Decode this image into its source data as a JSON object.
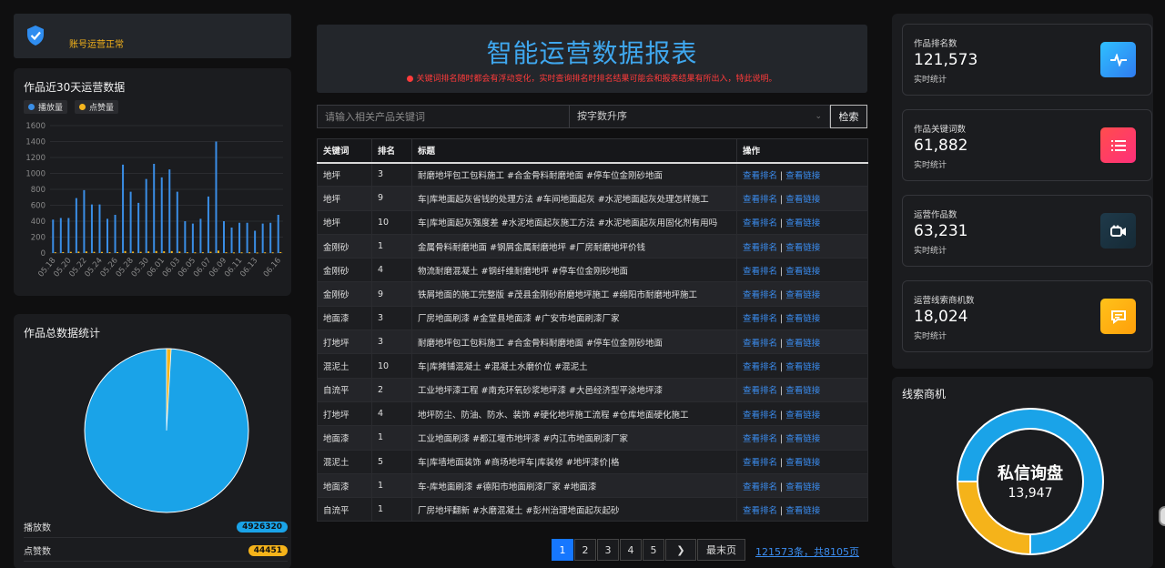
{
  "status": {
    "text": "账号运营正常"
  },
  "trend": {
    "title": "作品近30天运营数据",
    "legend": [
      "播放量",
      "点赞量"
    ],
    "colors": {
      "play": "#3a8ee6",
      "like": "#f6b61e"
    }
  },
  "chart_data": {
    "type": "bar",
    "xlabel": "",
    "ylabel": "",
    "ylim": [
      0,
      1600
    ],
    "yticks": [
      0,
      200,
      400,
      600,
      800,
      1000,
      1200,
      1400,
      1600
    ],
    "categories": [
      "05.18",
      "05.19",
      "05.20",
      "05.21",
      "05.22",
      "05.23",
      "05.24",
      "05.25",
      "05.26",
      "05.27",
      "05.28",
      "05.29",
      "05.30",
      "05.31",
      "06.01",
      "06.02",
      "06.03",
      "06.04",
      "06.05",
      "06.06",
      "06.07",
      "06.08",
      "06.09",
      "06.10",
      "06.11",
      "06.12",
      "06.13",
      "06.14",
      "06.15",
      "06.16"
    ],
    "tick_labels": [
      "05.18",
      "05.20",
      "05.22",
      "05.24",
      "05.26",
      "05.28",
      "05.30",
      "06.01",
      "06.03",
      "06.05",
      "06.07",
      "06.09",
      "06.11",
      "06.13",
      "06.16"
    ],
    "series": [
      {
        "name": "播放量",
        "values": [
          420,
          440,
          440,
          690,
          790,
          610,
          610,
          430,
          480,
          1110,
          770,
          630,
          930,
          1120,
          950,
          1050,
          770,
          400,
          370,
          430,
          710,
          1400,
          400,
          320,
          380,
          380,
          280,
          370,
          380,
          480
        ]
      },
      {
        "name": "点赞量",
        "values": [
          10,
          12,
          15,
          18,
          20,
          15,
          14,
          10,
          12,
          25,
          18,
          15,
          20,
          25,
          22,
          24,
          18,
          10,
          9,
          10,
          16,
          30,
          10,
          8,
          9,
          9,
          7,
          9,
          9,
          12
        ]
      }
    ]
  },
  "total": {
    "title": "作品总数据统计",
    "rows": [
      {
        "label": "播放数",
        "value": "4926320",
        "color": "#1aa3e8"
      },
      {
        "label": "点赞数",
        "value": "44451",
        "color": "#f5b31a"
      }
    ],
    "pie": {
      "play": 4926320,
      "like": 44451,
      "play_color": "#1aa3e8",
      "like_color": "#f5b31a"
    }
  },
  "header": {
    "title": "智能运营数据报表",
    "notice": "关键词排名随时都会有浮动变化，实时查询排名时排名结果可能会和报表结果有所出入，特此说明。"
  },
  "search": {
    "placeholder": "请输入相关产品关键词",
    "sort": "按字数升序",
    "button": "检索"
  },
  "table": {
    "headers": [
      "关键词",
      "排名",
      "标题",
      "操作"
    ],
    "action1": "查看排名",
    "action2": "查看链接",
    "rows": [
      [
        "地坪",
        "3",
        "耐磨地坪包工包料施工 #合金骨料耐磨地面 #停车位金刚砂地面"
      ],
      [
        "地坪",
        "9",
        "车|库地面起灰省钱的处理方法 #车间地面起灰 #水泥地面起灰处理怎样施工"
      ],
      [
        "地坪",
        "10",
        "车|库地面起灰强度差 #水泥地面起灰施工方法 #水泥地面起灰用固化剂有用吗"
      ],
      [
        "金刚砂",
        "1",
        "金属骨料耐磨地面 #钢屑金属耐磨地坪 #厂房耐磨地坪价钱"
      ],
      [
        "金刚砂",
        "4",
        "物流耐磨混凝土 #钢纤维耐磨地坪 #停车位金刚砂地面"
      ],
      [
        "金刚砂",
        "9",
        "铁屑地面的施工完整版 #茂县金刚砂耐磨地坪施工 #绵阳市耐磨地坪施工"
      ],
      [
        "地面漆",
        "3",
        "厂房地面刷漆 #金堂县地面漆 #广安市地面刷漆厂家"
      ],
      [
        "打地坪",
        "3",
        "耐磨地坪包工包料施工 #合金骨料耐磨地面 #停车位金刚砂地面"
      ],
      [
        "混泥土",
        "10",
        "车|库摊铺混凝土 #混凝土水磨价位 #混泥土"
      ],
      [
        "自流平",
        "2",
        "工业地坪漆工程 #南充环氧砂浆地坪漆 #大邑经济型平涂地坪漆"
      ],
      [
        "打地坪",
        "4",
        "地坪防尘、防油、防水、装饰 #硬化地坪施工流程 #仓库地面硬化施工"
      ],
      [
        "地面漆",
        "1",
        "工业地面刷漆 #都江堰市地坪漆 #内江市地面刷漆厂家"
      ],
      [
        "混泥土",
        "5",
        "车|库墙地面装饰 #商场地坪车|库装修 #地坪漆价|格"
      ],
      [
        "地面漆",
        "1",
        "车-库地面刷漆 #德阳市地面刷漆厂家 #地面漆"
      ],
      [
        "自流平",
        "1",
        "厂房地坪翻新 #水磨混凝土 #彭州治理地面起灰起砂"
      ]
    ]
  },
  "pager": {
    "pages": [
      "1",
      "2",
      "3",
      "4",
      "5"
    ],
    "current": "1",
    "next": "❯",
    "last": "最末页",
    "info": "121573条，共8105页"
  },
  "cards": [
    {
      "label": "作品排名数",
      "value": "121,573",
      "sub": "实时统计",
      "icon": "activity-icon",
      "grad": [
        "#2fc0ff",
        "#2f7bf0"
      ]
    },
    {
      "label": "作品关键词数",
      "value": "61,882",
      "sub": "实时统计",
      "icon": "list-icon",
      "grad": [
        "#ff4d4d",
        "#ff2f7a"
      ]
    },
    {
      "label": "运营作品数",
      "value": "63,231",
      "sub": "实时统计",
      "icon": "video-icon",
      "grad": [
        "#1f3a4a",
        "#162a36"
      ]
    },
    {
      "label": "运营线索商机数",
      "value": "18,024",
      "sub": "实时统计",
      "icon": "chat-icon",
      "grad": [
        "#ffc21a",
        "#ff9f0a"
      ]
    }
  ],
  "leads": {
    "title": "线索商机",
    "ring_title": "私信询盘",
    "ring_value": "13,947",
    "ring": {
      "blue_share": 0.75,
      "yellow_share": 0.25,
      "blue": "#1aa3e8",
      "yellow": "#f5b31a"
    }
  }
}
